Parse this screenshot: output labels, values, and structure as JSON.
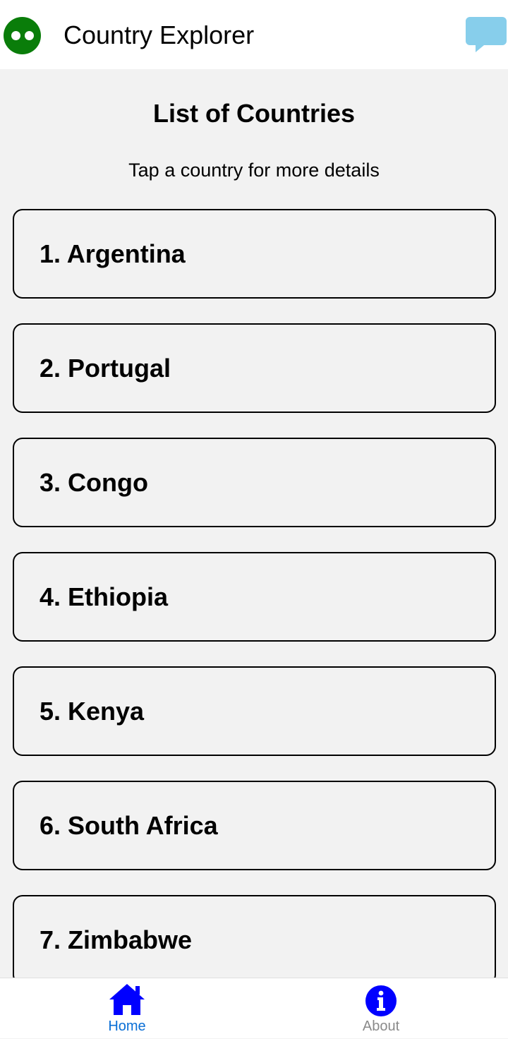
{
  "header": {
    "title": "Country Explorer",
    "logo_icon": "eyes-icon",
    "action_icon": "chat-bubble-icon",
    "logo_color": "#0a7d0a",
    "action_color": "#87ceeb"
  },
  "main": {
    "title": "List of Countries",
    "subtitle": "Tap a country for more details",
    "countries": [
      {
        "label": "1. Argentina"
      },
      {
        "label": "2. Portugal"
      },
      {
        "label": "3. Congo"
      },
      {
        "label": "4. Ethiopia"
      },
      {
        "label": "5. Kenya"
      },
      {
        "label": "6. South Africa"
      },
      {
        "label": "7. Zimbabwe"
      }
    ]
  },
  "tabbar": {
    "tabs": [
      {
        "label": "Home",
        "icon": "home-icon",
        "active": true,
        "color": "#0a6fd6"
      },
      {
        "label": "About",
        "icon": "info-icon",
        "active": false,
        "color": "#8a8a8a"
      }
    ],
    "icon_color": "#0000ff"
  }
}
